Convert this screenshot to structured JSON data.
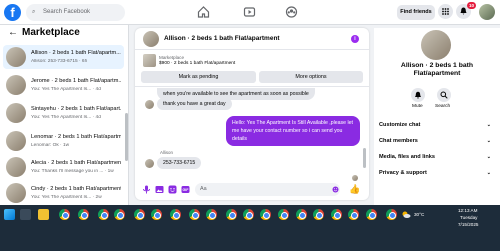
{
  "topbar": {
    "logo": "f",
    "search_placeholder": "Search Facebook",
    "find_friends": "Find friends",
    "notification_count": "10",
    "nav_icons": [
      "home-icon",
      "video-icon",
      "groups-icon"
    ]
  },
  "sidebar": {
    "title": "Marketplace",
    "back": "←",
    "conversations": [
      {
        "title": "Allison · 2 beds 1 bath Flat/apartm...",
        "preview": "Allison: 253-733-6715 · 6h",
        "active": true
      },
      {
        "title": "Jerome · 2 beds 1 bath Flat/apartm...",
        "preview": "You: Yes The Apartment Is... · 4d",
        "active": false
      },
      {
        "title": "Sintayehu · 2 beds 1 bath Flat/apart...",
        "preview": "You: Yes The Apartment Is... · 4d",
        "active": false
      },
      {
        "title": "Lenomar · 2 beds 1 bath Flat/apartm...",
        "preview": "Lenomar: Ok · 1w",
        "active": false
      },
      {
        "title": "Alecia · 2 beds 1 bath Flat/apartment",
        "preview": "You: Thanks I'll message you in ... · 1w",
        "active": false
      },
      {
        "title": "Cindy · 2 beds 1 bath Flat/apartment",
        "preview": "You: Yes The Apartment Is... · 2w",
        "active": false
      }
    ]
  },
  "chat": {
    "title": "Allison · 2 beds 1 bath Flat/apartment",
    "listing_source": "Marketplace",
    "listing_detail": "$900 · 2 beds 1 bath Flat/apartment",
    "mark_pending": "Mark as pending",
    "more_options": "More options",
    "messages": {
      "incoming_1": "when you're available to see the apartment as soon as possible",
      "incoming_2": "thank you have a great day",
      "outgoing_1": "Hello: Yes The Apartment Is Still Available ,please let me have your contact number so i can send you details",
      "sender_label": "Allison",
      "incoming_3": "253-733-6715"
    },
    "input_placeholder": "Aa"
  },
  "right_panel": {
    "name": "Allison · 2 beds 1 bath Flat/apartment",
    "mute": "Mute",
    "search": "Search",
    "rows": [
      "Customize chat",
      "Chat members",
      "Media, files and links",
      "Privacy & support"
    ]
  },
  "taskbar": {
    "weather": "30°C",
    "time": "12:13 AM",
    "day": "Tuesday",
    "date": "7/15/2025"
  }
}
